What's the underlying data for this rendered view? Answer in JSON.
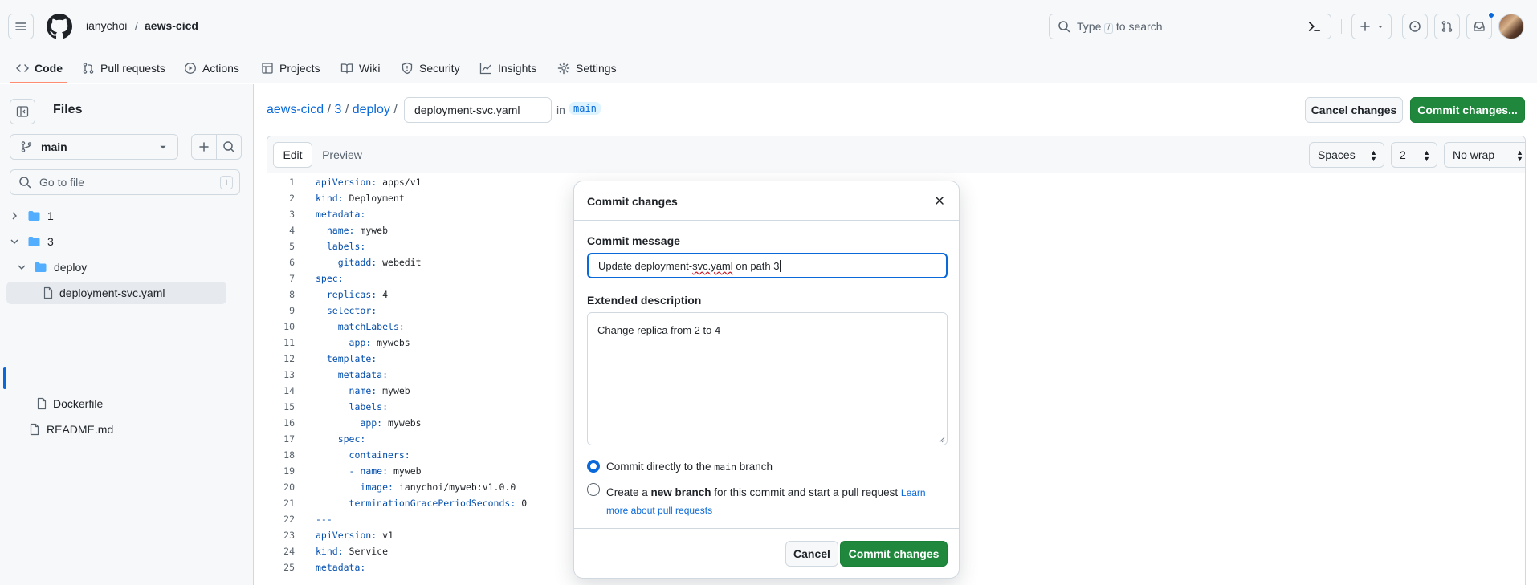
{
  "header": {
    "owner": "ianychoi",
    "separator": "/",
    "repo": "aews-cicd",
    "search_placeholder_prefix": "Type",
    "search_placeholder_key": "/",
    "search_placeholder_suffix": "to search",
    "nav": [
      {
        "label": "Code",
        "icon": "code-icon"
      },
      {
        "label": "Pull requests",
        "icon": "pull-request-icon"
      },
      {
        "label": "Actions",
        "icon": "play-icon"
      },
      {
        "label": "Projects",
        "icon": "table-icon"
      },
      {
        "label": "Wiki",
        "icon": "book-icon"
      },
      {
        "label": "Security",
        "icon": "shield-icon"
      },
      {
        "label": "Insights",
        "icon": "graph-icon"
      },
      {
        "label": "Settings",
        "icon": "gear-icon"
      }
    ]
  },
  "sidebar": {
    "title": "Files",
    "branch": "main",
    "goto_placeholder": "Go to file",
    "goto_key": "t",
    "tree": [
      {
        "name": "1",
        "type": "folder",
        "expanded": false
      },
      {
        "name": "3",
        "type": "folder",
        "expanded": true
      },
      {
        "name": "deploy",
        "type": "folder",
        "expanded": true
      },
      {
        "name": "deployment-svc.yaml",
        "type": "file",
        "selected": true
      },
      {
        "name": "Dockerfile",
        "type": "file"
      },
      {
        "name": "README.md",
        "type": "file"
      }
    ]
  },
  "main": {
    "path_repo": "aews-cicd",
    "path_dir1": "3",
    "path_dir2": "deploy",
    "filename": "deployment-svc.yaml",
    "in_label": "in",
    "branch": "main",
    "cancel_label": "Cancel changes",
    "commit_label": "Commit changes...",
    "tab_edit": "Edit",
    "tab_preview": "Preview",
    "indent_mode": "Spaces",
    "indent_size": "2",
    "wrap_mode": "No wrap",
    "lines": [
      {
        "n": "1",
        "k": "apiVersion:",
        "v": " apps/v1",
        "indent": ""
      },
      {
        "n": "2",
        "k": "kind:",
        "v": " Deployment",
        "indent": ""
      },
      {
        "n": "3",
        "k": "metadata:",
        "v": "",
        "indent": ""
      },
      {
        "n": "4",
        "k": "name:",
        "v": " myweb",
        "indent": "  "
      },
      {
        "n": "5",
        "k": "labels:",
        "v": "",
        "indent": "  "
      },
      {
        "n": "6",
        "k": "gitadd:",
        "v": " webedit",
        "indent": "    "
      },
      {
        "n": "7",
        "k": "spec:",
        "v": "",
        "indent": ""
      },
      {
        "n": "8",
        "k": "replicas:",
        "v": " 4",
        "indent": "  "
      },
      {
        "n": "9",
        "k": "selector:",
        "v": "",
        "indent": "  "
      },
      {
        "n": "10",
        "k": "matchLabels:",
        "v": "",
        "indent": "    "
      },
      {
        "n": "11",
        "k": "app:",
        "v": " mywebs",
        "indent": "      "
      },
      {
        "n": "12",
        "k": "template:",
        "v": "",
        "indent": "  "
      },
      {
        "n": "13",
        "k": "metadata:",
        "v": "",
        "indent": "    "
      },
      {
        "n": "14",
        "k": "name:",
        "v": " myweb",
        "indent": "      "
      },
      {
        "n": "15",
        "k": "labels:",
        "v": "",
        "indent": "      "
      },
      {
        "n": "16",
        "k": "app:",
        "v": " mywebs",
        "indent": "        "
      },
      {
        "n": "17",
        "k": "spec:",
        "v": "",
        "indent": "    "
      },
      {
        "n": "18",
        "k": "containers:",
        "v": "",
        "indent": "      "
      },
      {
        "n": "19",
        "k": "- name:",
        "v": " myweb",
        "indent": "      "
      },
      {
        "n": "20",
        "k": "image:",
        "v": " ianychoi/myweb:v1.0.0",
        "indent": "        "
      },
      {
        "n": "21",
        "k": "terminationGracePeriodSeconds:",
        "v": " 0",
        "indent": "      "
      },
      {
        "n": "22",
        "k": "---",
        "v": "",
        "indent": ""
      },
      {
        "n": "23",
        "k": "apiVersion:",
        "v": " v1",
        "indent": ""
      },
      {
        "n": "24",
        "k": "kind:",
        "v": " Service",
        "indent": ""
      },
      {
        "n": "25",
        "k": "metadata:",
        "v": "",
        "indent": ""
      }
    ]
  },
  "modal": {
    "title": "Commit changes",
    "message_label": "Commit message",
    "message_pre": "Update deployment-",
    "message_err": "svc.yaml",
    "message_post": " on path 3",
    "desc_label": "Extended description",
    "desc_value": "Change replica from 2 to 4",
    "opt1_pre": "Commit directly to the ",
    "opt1_code": "main",
    "opt1_post": " branch",
    "opt2_pre": "Create a ",
    "opt2_bold": "new branch",
    "opt2_post": " for this commit and start a pull request ",
    "opt2_link1": "Learn",
    "opt2_link2": "more about pull requests",
    "cancel_label": "Cancel",
    "commit_label": "Commit changes"
  },
  "colors": {
    "accent": "#0969da",
    "primary_button": "#1f883d",
    "folder": "#54aeff",
    "nav_underline": "#fd8c73"
  }
}
